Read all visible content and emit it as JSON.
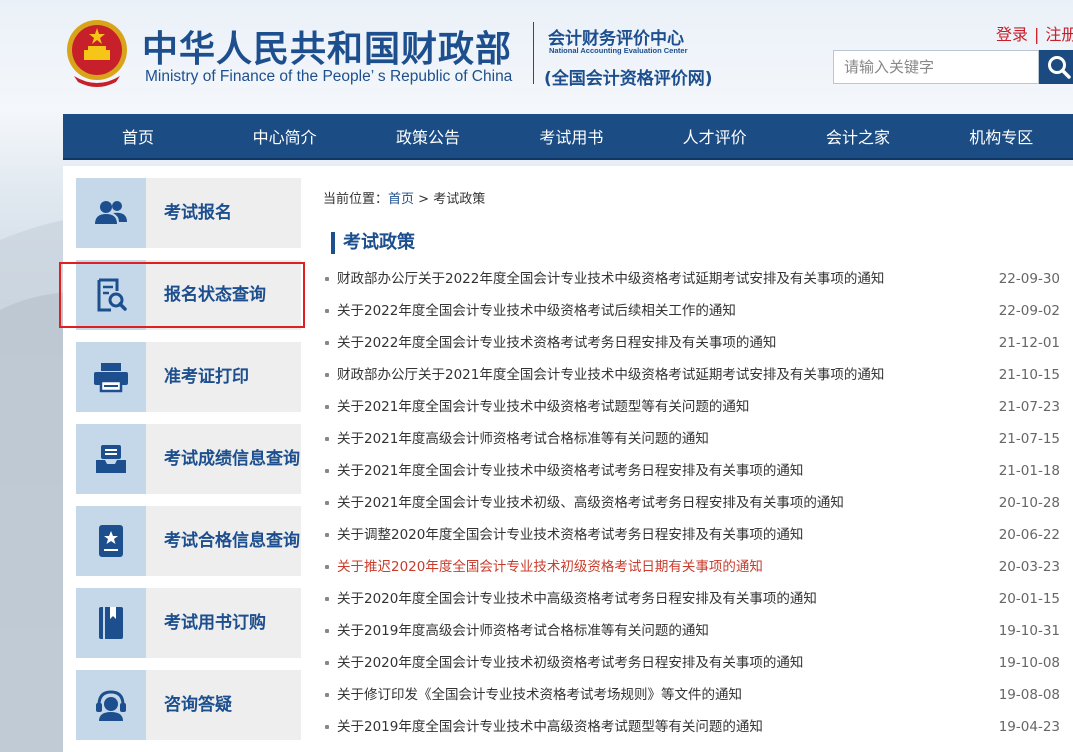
{
  "header": {
    "title_cn": "中华人民共和国财政部",
    "title_en": "Ministry of Finance of the People’ s Republic of China",
    "center_cn": "会计财务评价中心",
    "center_en": "National Accounting Evaluation Center",
    "center_sub": "(全国会计资格评价网)",
    "login_label": "登录",
    "register_label": "注册",
    "search_placeholder": "请输入关键字"
  },
  "nav": {
    "items": [
      {
        "label": "首页"
      },
      {
        "label": "中心简介"
      },
      {
        "label": "政策公告"
      },
      {
        "label": "考试用书"
      },
      {
        "label": "人才评价"
      },
      {
        "label": "会计之家"
      },
      {
        "label": "机构专区"
      }
    ]
  },
  "sidebar": {
    "items": [
      {
        "label": "考试报名",
        "icon": "users-icon"
      },
      {
        "label": "报名状态查询",
        "icon": "document-search-icon"
      },
      {
        "label": "准考证打印",
        "icon": "printer-icon"
      },
      {
        "label": "考试成绩信息查询",
        "icon": "inbox-icon"
      },
      {
        "label": "考试合格信息查询",
        "icon": "certificate-icon"
      },
      {
        "label": "考试用书订购",
        "icon": "book-icon"
      },
      {
        "label": "咨询答疑",
        "icon": "headset-icon"
      }
    ]
  },
  "content": {
    "breadcrumb": {
      "prefix": "当前位置：",
      "home": "首页",
      "sep": " > ",
      "current": "考试政策"
    },
    "section_title": "考试政策",
    "articles": [
      {
        "title": "财政部办公厅关于2022年度全国会计专业技术中级资格考试延期考试安排及有关事项的通知",
        "date": "22-09-30"
      },
      {
        "title": "关于2022年度全国会计专业技术中级资格考试后续相关工作的通知",
        "date": "22-09-02"
      },
      {
        "title": "关于2022年度全国会计专业技术资格考试考务日程安排及有关事项的通知",
        "date": "21-12-01"
      },
      {
        "title": "财政部办公厅关于2021年度全国会计专业技术中级资格考试延期考试安排及有关事项的通知",
        "date": "21-10-15"
      },
      {
        "title": "关于2021年度全国会计专业技术中级资格考试题型等有关问题的通知",
        "date": "21-07-23"
      },
      {
        "title": "关于2021年度高级会计师资格考试合格标准等有关问题的通知",
        "date": "21-07-15"
      },
      {
        "title": "关于2021年度全国会计专业技术中级资格考试考务日程安排及有关事项的通知",
        "date": "21-01-18"
      },
      {
        "title": "关于2021年度全国会计专业技术初级、高级资格考试考务日程安排及有关事项的通知",
        "date": "20-10-28"
      },
      {
        "title": "关于调整2020年度全国会计专业技术资格考试考务日程安排及有关事项的通知",
        "date": "20-06-22"
      },
      {
        "title": "关于推迟2020年度全国会计专业技术初级资格考试日期有关事项的通知",
        "date": "20-03-23"
      },
      {
        "title": "关于2020年度全国会计专业技术中高级资格考试考务日程安排及有关事项的通知",
        "date": "20-01-15"
      },
      {
        "title": "关于2019年度高级会计师资格考试合格标准等有关问题的通知",
        "date": "19-10-31"
      },
      {
        "title": "关于2020年度全国会计专业技术初级资格考试考务日程安排及有关事项的通知",
        "date": "19-10-08"
      },
      {
        "title": "关于修订印发《全国会计专业技术资格考试考场规则》等文件的通知",
        "date": "19-08-08"
      },
      {
        "title": "关于2019年度全国会计专业技术中高级资格考试题型等有关问题的通知",
        "date": "19-04-23"
      }
    ]
  },
  "colors": {
    "brand_blue": "#1d4f8e",
    "nav_blue": "#1b4c84",
    "highlight_red": "#e02020",
    "link_red": "#c83c2c"
  }
}
